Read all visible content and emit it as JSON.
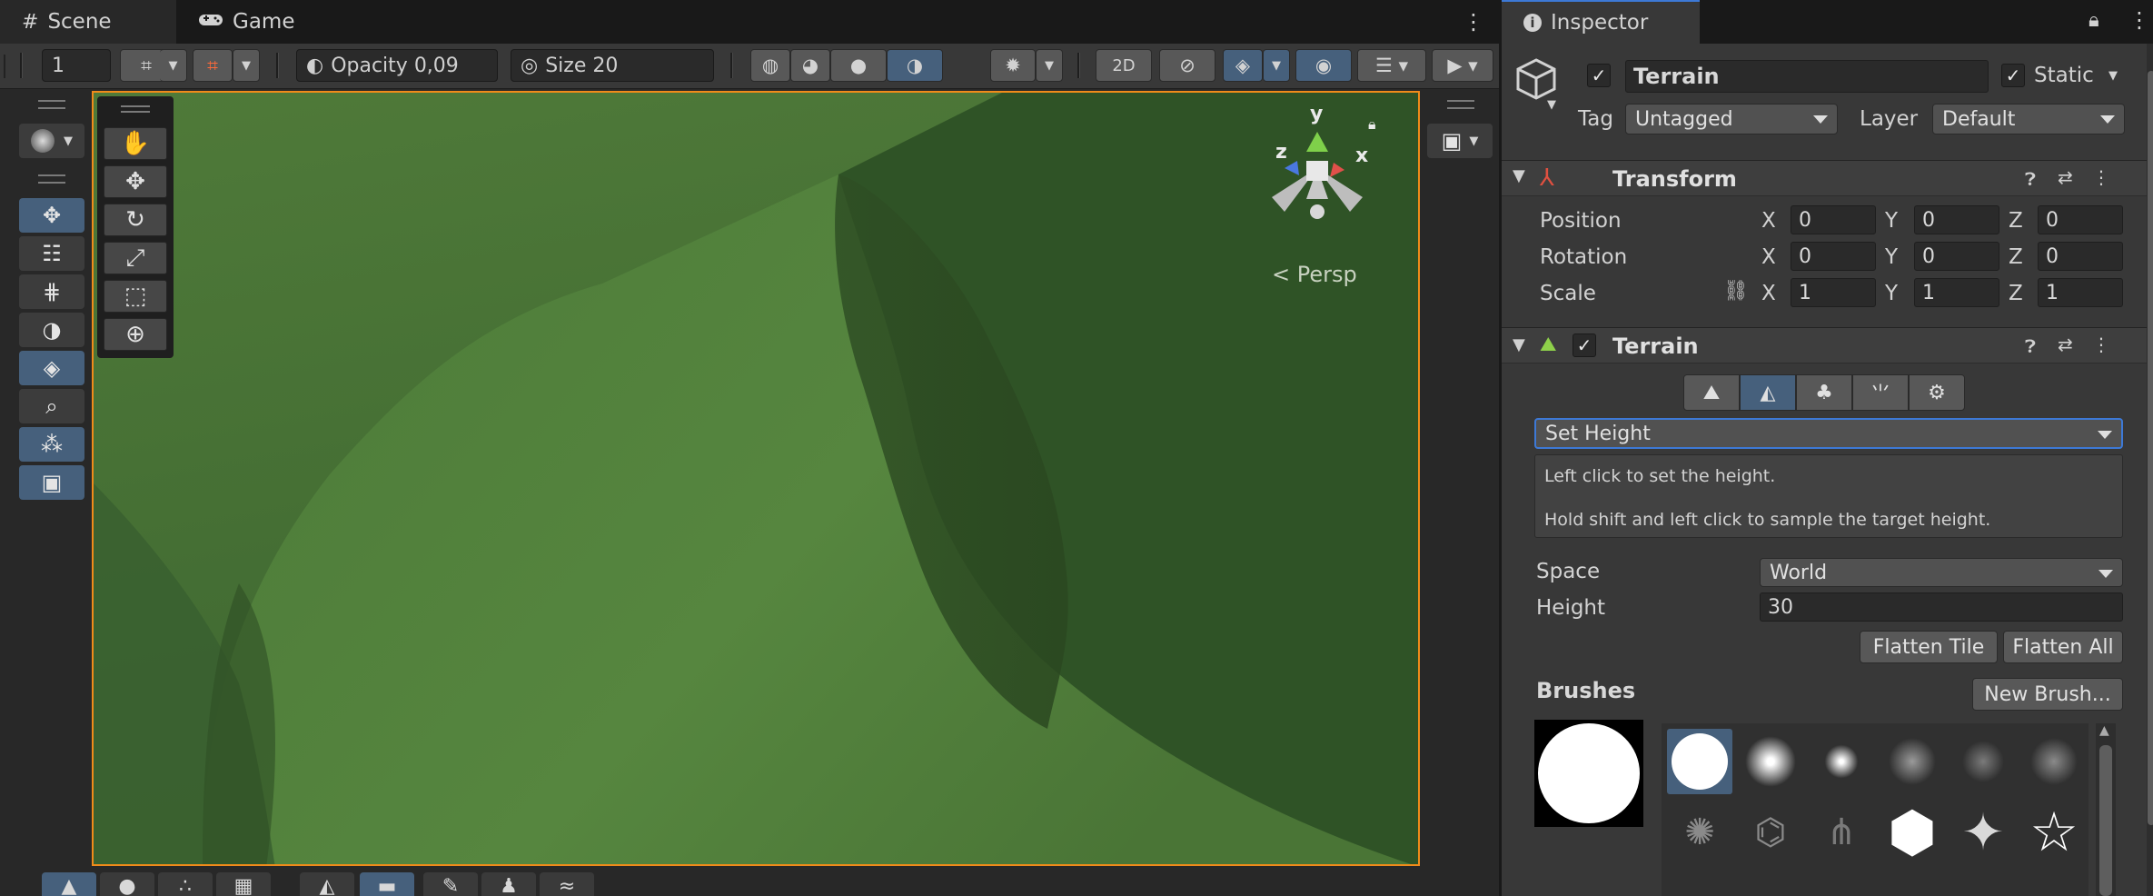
{
  "scene_tabs": {
    "scene": "Scene",
    "game": "Game"
  },
  "toolbar": {
    "layer_value": "1",
    "opacity_label": "Opacity 0,09",
    "size_label": "Size 20"
  },
  "viewport": {
    "projection_label": "Persp",
    "gizmo_axes": {
      "y": "y",
      "x": "x",
      "z": "z"
    }
  },
  "inspector": {
    "tab_title": "Inspector",
    "object": {
      "name": "Terrain",
      "active": true,
      "static_label": "Static",
      "static": true,
      "tag_label": "Tag",
      "tag_value": "Untagged",
      "layer_label": "Layer",
      "layer_value": "Default"
    },
    "transform": {
      "title": "Transform",
      "rows": [
        {
          "label": "Position",
          "x": "0",
          "y": "0",
          "z": "0"
        },
        {
          "label": "Rotation",
          "x": "0",
          "y": "0",
          "z": "0"
        },
        {
          "label": "Scale",
          "x": "1",
          "y": "1",
          "z": "1"
        }
      ],
      "axis_x": "X",
      "axis_y": "Y",
      "axis_z": "Z"
    },
    "terrain": {
      "title": "Terrain",
      "enabled": true,
      "tool_mode": "Set Height",
      "help_line1": "Left click to set the height.",
      "help_line2": "Hold shift and left click to sample the target height.",
      "space_label": "Space",
      "space_value": "World",
      "height_label": "Height",
      "height_value": "30",
      "flatten_tile": "Flatten Tile",
      "flatten_all": "Flatten All",
      "brushes_label": "Brushes",
      "new_brush": "New Brush..."
    }
  },
  "colors": {
    "accent_blue": "#46607c",
    "selection_outline": "#f08b1a",
    "inspector_bg": "#383838",
    "focus_blue": "#3d79d6"
  }
}
